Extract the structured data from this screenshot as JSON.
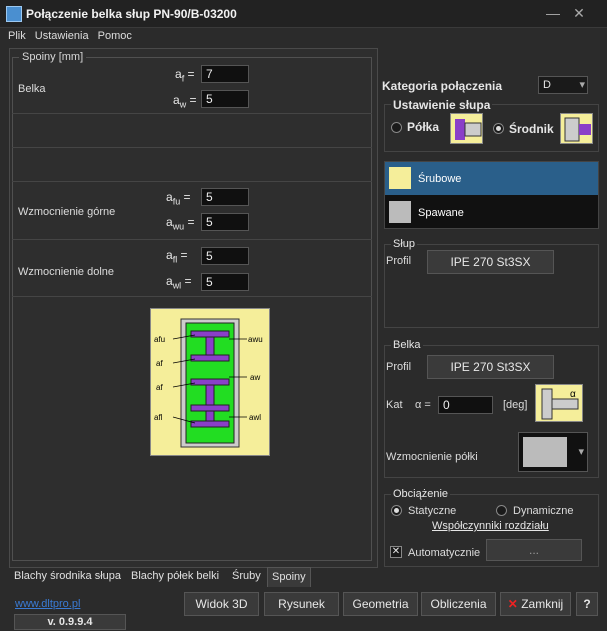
{
  "window": {
    "title": "Połączenie belka słup  PN-90/B-03200",
    "minimize": "—",
    "close": "✕"
  },
  "menu": [
    "Plik",
    "Ustawienia",
    "Pomoc"
  ],
  "spoiny": {
    "group_title": "Spoiny [mm]",
    "belka": {
      "label": "Belka",
      "af_val": "7",
      "aw_val": "5",
      "af": "a",
      "af_sub": "f",
      "aw": "a",
      "aw_sub": "w"
    },
    "wzm_gorne": {
      "label": "Wzmocnienie górne",
      "afu_val": "5",
      "awu_val": "5",
      "afu_sub": "fu",
      "awu_sub": "wu"
    },
    "wzm_dolne": {
      "label": "Wzmocnienie dolne",
      "afl_val": "5",
      "awl_val": "5",
      "afl_sub": "fl",
      "awl_sub": "wl"
    },
    "eq": "="
  },
  "diagram": {
    "labels_left": [
      "afu",
      "af",
      "af",
      "afl"
    ],
    "labels_right": [
      "awu",
      "aw",
      "awl"
    ]
  },
  "tabs": [
    "Blachy środnika słupa",
    "Blachy półek belki",
    "Śruby",
    "Spoiny"
  ],
  "link": "www.dltpro.pl",
  "version": "v. 0.9.9.4",
  "kategoria": {
    "label": "Kategoria połączenia",
    "value": "D"
  },
  "ustawienie": {
    "title": "Ustawienie słupa",
    "polka": "Półka",
    "srodnik": "Środnik"
  },
  "typ_list": [
    "Śrubowe",
    "Spawane"
  ],
  "slup": {
    "title": "Słup",
    "profil_label": "Profil",
    "profil": "IPE 270 St3SX"
  },
  "belka": {
    "title": "Belka",
    "profil_label": "Profil",
    "profil": "IPE 270 St3SX",
    "kat_label": "Kat",
    "alpha": "α =",
    "alpha_val": "0",
    "unit": "[deg]",
    "wzm_label": "Wzmocnienie półki"
  },
  "obciazenie": {
    "title": "Obciążenie",
    "statyczne": "Statyczne",
    "dynamiczne": "Dynamiczne",
    "wspolczynniki": "Współczynniki rozdziału",
    "auto": "Automatycznie",
    "dots": "..."
  },
  "buttons": {
    "widok3d": "Widok 3D",
    "rysunek": "Rysunek",
    "geometria": "Geometria",
    "obliczenia": "Obliczenia",
    "zamknij": "Zamknij",
    "help": "?"
  },
  "colors": {
    "green": "#22dd22",
    "purple": "#8a3fc8",
    "yellow": "#f5ee9a",
    "selected": "#2a5f8a"
  }
}
